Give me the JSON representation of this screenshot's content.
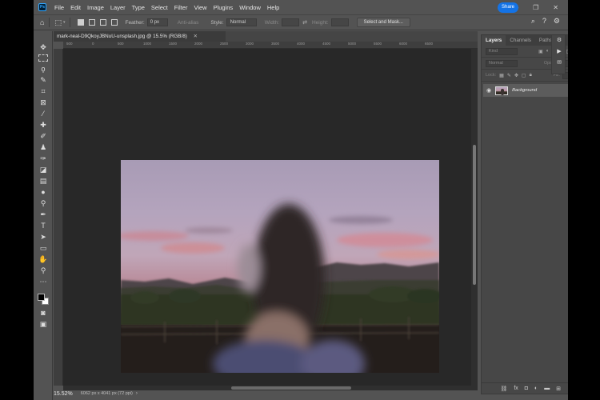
{
  "app": {
    "logo": "Ps",
    "menu": [
      "File",
      "Edit",
      "Image",
      "Layer",
      "Type",
      "Select",
      "Filter",
      "View",
      "Plugins",
      "Window",
      "Help"
    ],
    "window_controls": [
      "—",
      "❐",
      "✕"
    ]
  },
  "options": {
    "feather_label": "Feather:",
    "feather_value": "0 px",
    "antialias_label": "Anti-alias",
    "style_label": "Style:",
    "style_value": "Normal",
    "width_label": "Width:",
    "height_label": "Height:",
    "select_mask_label": "Select and Mask...",
    "share_label": "Share"
  },
  "document": {
    "tab_title": "mark-neal-D9QkoyJBNuU-unsplash.jpg @ 15.5% (RGB/8)",
    "zoom": "15.52%",
    "info": "6062 px x 4041 px (72 ppi)",
    "ruler_h": [
      "500",
      "0",
      "500",
      "1000",
      "1500",
      "2000",
      "2500",
      "3000",
      "3500",
      "4000",
      "4500",
      "5000",
      "5500",
      "6000",
      "6500"
    ]
  },
  "layers_panel": {
    "tabs": [
      "Layers",
      "Channels",
      "Paths"
    ],
    "kind_label": "Kind",
    "blend_mode": "Normal",
    "opacity_label": "Opacity:",
    "lock_label": "Lock:",
    "fill_label": "Fill:",
    "layer_name": "Background"
  },
  "colors": {
    "app_bg": "#535353",
    "canvas_bg": "#282828",
    "accent": "#1473e6",
    "ps_blue": "#31a8ff"
  },
  "icons": {
    "home": "home-icon",
    "search": "search-icon",
    "help": "help-icon",
    "settings": "settings-icon"
  }
}
